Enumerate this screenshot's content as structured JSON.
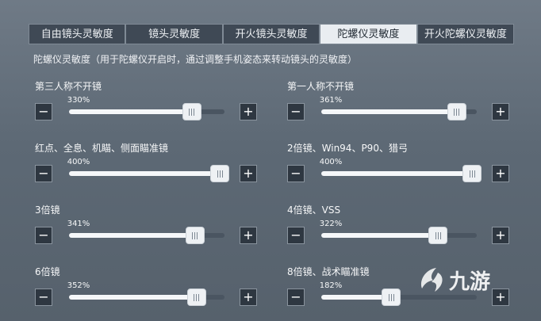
{
  "tabs": [
    {
      "label": "自由镜头灵敏度",
      "active": false
    },
    {
      "label": "镜头灵敏度",
      "active": false
    },
    {
      "label": "开火镜头灵敏度",
      "active": false
    },
    {
      "label": "陀螺仪灵敏度",
      "active": true
    },
    {
      "label": "开火陀螺仪灵敏度",
      "active": false
    }
  ],
  "subtitle": "陀螺仪灵敏度（用于陀螺仪开启时，通过调整手机姿态来转动镜头的灵敏度）",
  "controls": {
    "decrease": "−",
    "increase": "+"
  },
  "sliders": [
    {
      "label": "第三人称不开镜",
      "value_text": "330%",
      "level": 0.79
    },
    {
      "label": "第一人称不开镜",
      "value_text": "361%",
      "level": 0.87
    },
    {
      "label": "红点、全息、机瞄、侧面瞄准镜",
      "value_text": "400%",
      "level": 0.97
    },
    {
      "label": "2倍镜、Win94、P90、猎弓",
      "value_text": "400%",
      "level": 0.97
    },
    {
      "label": "3倍镜",
      "value_text": "341%",
      "level": 0.81
    },
    {
      "label": "4倍镜、VSS",
      "value_text": "322%",
      "level": 0.75
    },
    {
      "label": "6倍镜",
      "value_text": "352%",
      "level": 0.82
    },
    {
      "label": "8倍镜、战术瞄准镜",
      "value_text": "182%",
      "level": 0.45
    }
  ],
  "watermark": {
    "text": "九游"
  }
}
